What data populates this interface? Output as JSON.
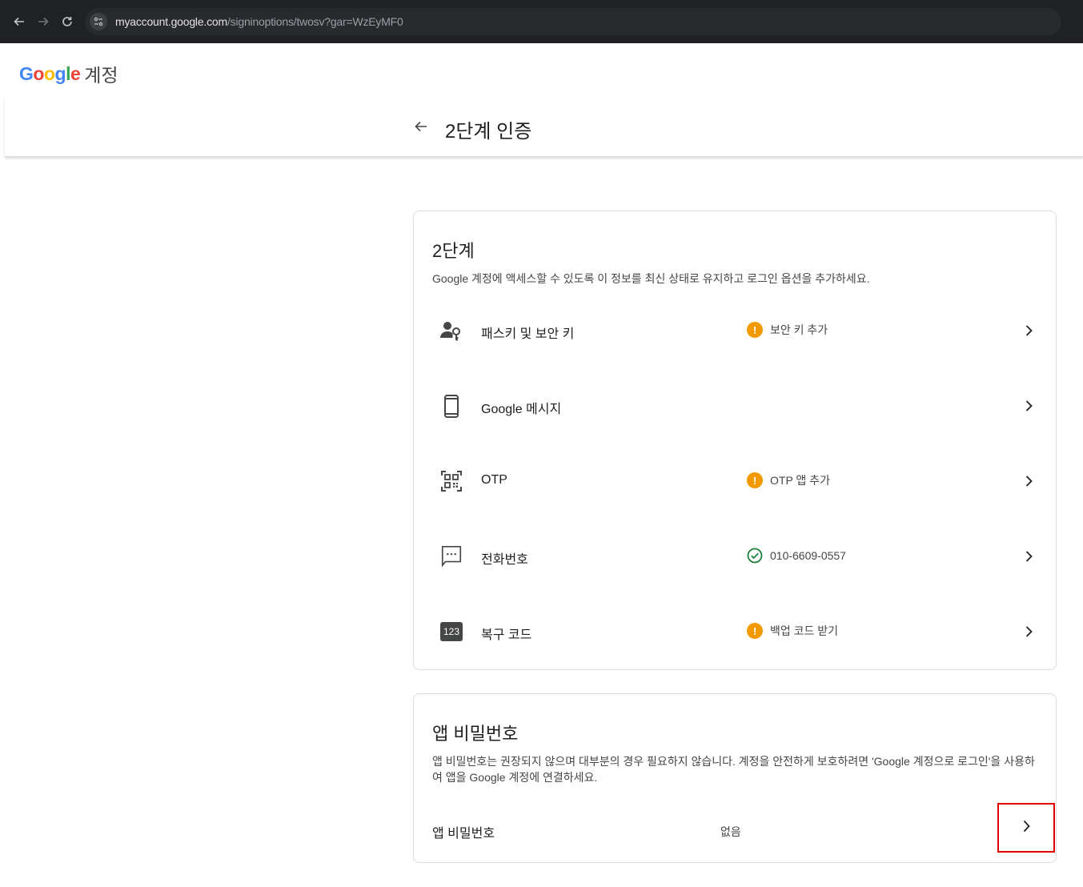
{
  "browser": {
    "url_host": "myaccount.google.com",
    "url_path": "/signinoptions/twosv?gar=WzEyMF0"
  },
  "header": {
    "logo_text": "Google",
    "product": "계정"
  },
  "page": {
    "title": "2단계 인증"
  },
  "two_step_card": {
    "title": "2단계",
    "description": "Google 계정에 액세스할 수 있도록 이 정보를 최신 상태로 유지하고 로그인 옵션을 추가하세요.",
    "rows": [
      {
        "label": "패스키 및 보안 키",
        "status": "보안 키 추가",
        "status_type": "warning",
        "icon": "passkey-icon"
      },
      {
        "label": "Google 메시지",
        "status": "",
        "status_type": "none",
        "icon": "phone-device-icon"
      },
      {
        "label": "OTP",
        "status": "OTP 앱 추가",
        "status_type": "warning",
        "icon": "qr-code-icon"
      },
      {
        "label": "전화번호",
        "status": "010-6609-0557",
        "status_type": "ok",
        "icon": "sms-icon"
      },
      {
        "label": "복구 코드",
        "status": "백업 코드 받기",
        "status_type": "warning",
        "icon": "backup-code-icon",
        "badge": "123"
      }
    ]
  },
  "app_password_card": {
    "title": "앱 비밀번호",
    "description": "앱 비밀번호는 권장되지 않으며 대부분의 경우 필요하지 않습니다. 계정을 안전하게 보호하려면 'Google 계정으로 로그인'을 사용하여 앱을 Google 계정에 연결하세요.",
    "row_label": "앱 비밀번호",
    "row_value": "없음"
  },
  "colors": {
    "warning": "#f29900",
    "ok": "#188038",
    "highlight": "#e00000"
  }
}
